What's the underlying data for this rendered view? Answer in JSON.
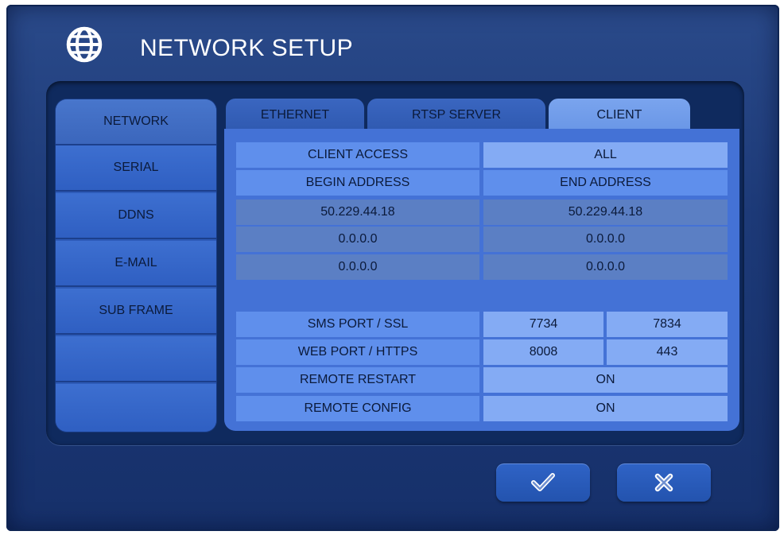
{
  "title": "NETWORK SETUP",
  "icons": {
    "title": "globe-icon",
    "confirm": "checkmark-icon",
    "cancel": "x-icon"
  },
  "sidebar": {
    "items": [
      {
        "label": "NETWORK",
        "active": true
      },
      {
        "label": "SERIAL"
      },
      {
        "label": "DDNS"
      },
      {
        "label": "E-MAIL"
      },
      {
        "label": "SUB FRAME"
      },
      {
        "label": ""
      },
      {
        "label": ""
      }
    ]
  },
  "tabs": [
    {
      "label": "ETHERNET"
    },
    {
      "label": "RTSP SERVER"
    },
    {
      "label": "CLIENT",
      "active": true
    }
  ],
  "client": {
    "access_label": "CLIENT ACCESS",
    "access_value": "ALL",
    "begin_header": "BEGIN ADDRESS",
    "end_header": "END ADDRESS",
    "ranges": [
      {
        "begin": "50.229.44.18",
        "end": "50.229.44.18"
      },
      {
        "begin": "0.0.0.0",
        "end": "0.0.0.0"
      },
      {
        "begin": "0.0.0.0",
        "end": "0.0.0.0"
      }
    ],
    "sms_port_label": "SMS PORT / SSL",
    "sms_port": "7734",
    "ssl_port": "7834",
    "web_port_label": "WEB PORT / HTTPS",
    "web_port": "8008",
    "https_port": "443",
    "remote_restart_label": "REMOTE RESTART",
    "remote_restart_value": "ON",
    "remote_config_label": "REMOTE CONFIG",
    "remote_config_value": "ON"
  },
  "colors": {
    "background": "#1d3a78",
    "active_tab": "#7aa4ee",
    "label_cell": "#5f8fec",
    "value_cell": "#84abf4"
  }
}
